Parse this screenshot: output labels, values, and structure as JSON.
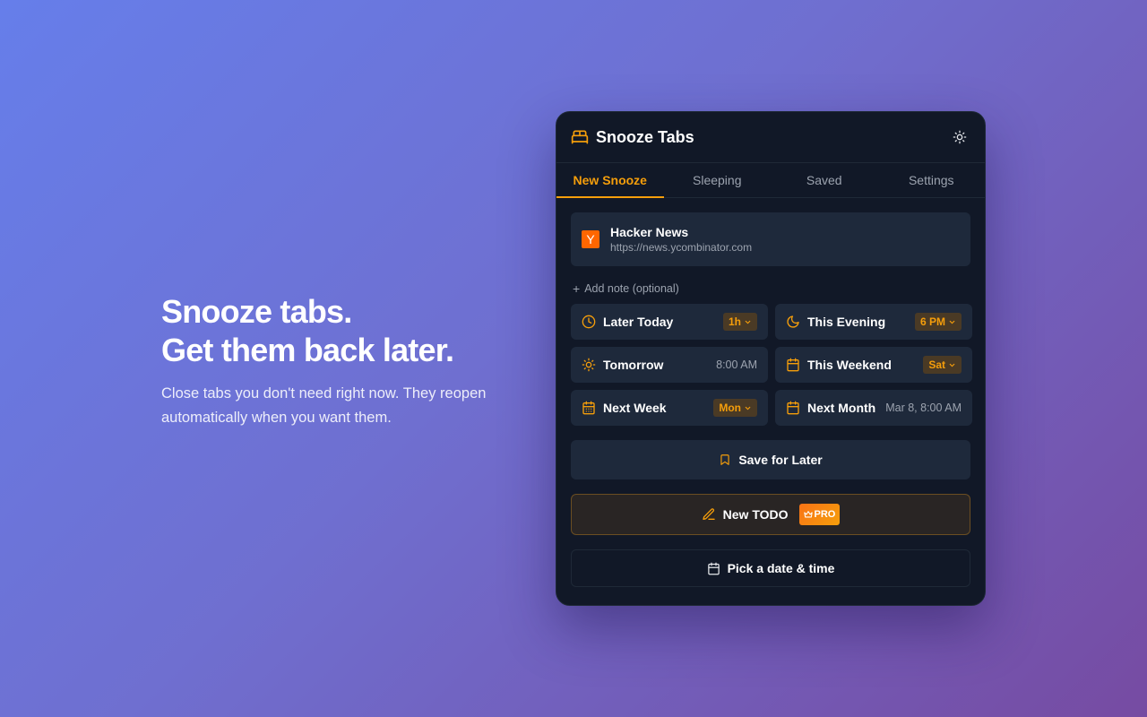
{
  "hero": {
    "heading_line1": "Snooze tabs.",
    "heading_line2": "Get them back later.",
    "description": "Close tabs you don't need right now. They reopen automatically when you want them."
  },
  "popup": {
    "title": "Snooze Tabs",
    "logo_icon": "bed-icon",
    "theme_icon": "sun-icon",
    "tabs": [
      {
        "label": "New Snooze",
        "active": true
      },
      {
        "label": "Sleeping",
        "active": false
      },
      {
        "label": "Saved",
        "active": false
      },
      {
        "label": "Settings",
        "active": false
      }
    ],
    "site": {
      "favicon_letter": "Y",
      "title": "Hacker News",
      "url": "https://news.ycombinator.com"
    },
    "add_note": "Add note (optional)",
    "options": [
      {
        "label": "Later Today",
        "icon": "clock-icon",
        "value": "1h",
        "dropdown": true
      },
      {
        "label": "This Evening",
        "icon": "moon-icon",
        "value": "6 PM",
        "dropdown": true
      },
      {
        "label": "Tomorrow",
        "icon": "sun-icon",
        "value": "8:00 AM",
        "dropdown": false
      },
      {
        "label": "This Weekend",
        "icon": "calendar-icon",
        "value": "Sat",
        "dropdown": true
      },
      {
        "label": "Next Week",
        "icon": "calendar-grid-icon",
        "value": "Mon",
        "dropdown": true
      },
      {
        "label": "Next Month",
        "icon": "calendar-icon",
        "value": "Mar 8, 8:00 AM",
        "dropdown": false
      }
    ],
    "save_for_later": "Save for Later",
    "new_todo": "New TODO",
    "pro_badge": "PRO",
    "pick_date": "Pick a date & time",
    "colors": {
      "accent": "#f59e0b",
      "panel": "#111827",
      "card": "#1e293b"
    }
  }
}
